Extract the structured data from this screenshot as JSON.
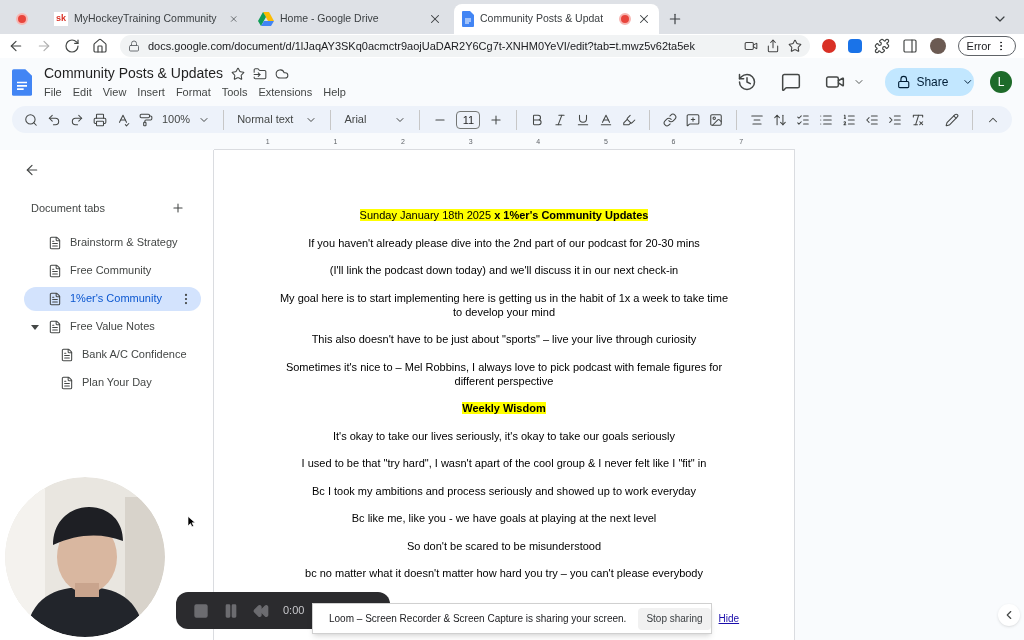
{
  "browser": {
    "tabs": [
      {
        "kind": "pinned",
        "selected": false
      },
      {
        "kind": "site",
        "favicon_text": "sk",
        "title": "MyHockeyTraining Community",
        "selected": false
      },
      {
        "kind": "drive",
        "title": "Home - Google Drive",
        "selected": false
      },
      {
        "kind": "docs",
        "title": "Community Posts & Updat",
        "selected": true
      }
    ],
    "url": "docs.google.com/document/d/1lJaqAY3SKq0acmctr9aojUaDAR2Y6Cg7t-XNHM0YeVI/edit?tab=t.mwz5v62ta5ek",
    "profile_button": "Error"
  },
  "doc": {
    "title": "Community Posts & Updates",
    "menu": [
      "File",
      "Edit",
      "View",
      "Insert",
      "Format",
      "Tools",
      "Extensions",
      "Help"
    ],
    "share": "Share",
    "avatar": "L"
  },
  "toolbar": {
    "zoom": "100%",
    "style": "Normal text",
    "font": "Arial",
    "size": "11"
  },
  "ruler_labels": [
    "1",
    "1",
    "2",
    "3",
    "4",
    "5",
    "6",
    "7"
  ],
  "sidebar": {
    "heading": "Document tabs",
    "items": [
      {
        "label": "Brainstorm & Strategy",
        "selected": false
      },
      {
        "label": "Free Community",
        "selected": false
      },
      {
        "label": "1%er's Community",
        "selected": true
      },
      {
        "label": "Free Value Notes",
        "selected": false,
        "expanded": true,
        "children": [
          {
            "label": "Bank A/C Confidence",
            "selected": false
          },
          {
            "label": "Plan Your Day",
            "selected": false
          }
        ]
      }
    ]
  },
  "paragraphs": [
    {
      "kind": "heading",
      "text": "Sunday January 18th 2025 **x 1%er's Community Updates**"
    },
    {
      "kind": "body",
      "text": "If you haven't already please dive into the 2nd part of our podcast for 20-30 mins"
    },
    {
      "kind": "body",
      "text": "(I'll link the podcast down today) and we'll discuss it in our next check-in"
    },
    {
      "kind": "body",
      "text": "My goal here is to start implementing here is getting us in the habit of 1x a week to take time to develop your mind"
    },
    {
      "kind": "body",
      "text": "This also doesn't have to be just about \"sports\" – live your live through curiosity"
    },
    {
      "kind": "body",
      "text": "Sometimes it's nice to – Mel Robbins, I always love to pick podcast with female figures for different perspective"
    },
    {
      "kind": "heading",
      "text": "**Weekly Wisdom**"
    },
    {
      "kind": "body",
      "text": "It's okay to take our lives seriously, it's okay to take our goals seriously"
    },
    {
      "kind": "body",
      "text": "I used to be that \"try hard\", I wasn't apart of the cool group & I never felt like I \"fit\" in"
    },
    {
      "kind": "body",
      "text": "Bc I took my ambitions and process seriously and showed up to work everyday"
    },
    {
      "kind": "body",
      "text": "Bc like me, like you - we have goals at playing at the next level"
    },
    {
      "kind": "body",
      "text": "So don't be scared to be misunderstood"
    },
    {
      "kind": "body",
      "text": "bc no matter what it doesn't matter how hard you try – you can't please everybody"
    }
  ],
  "loom": {
    "time": "0:00",
    "notice": "Loom – Screen Recorder & Screen Capture is sharing your screen.",
    "stop": "Stop sharing",
    "hide": "Hide"
  }
}
